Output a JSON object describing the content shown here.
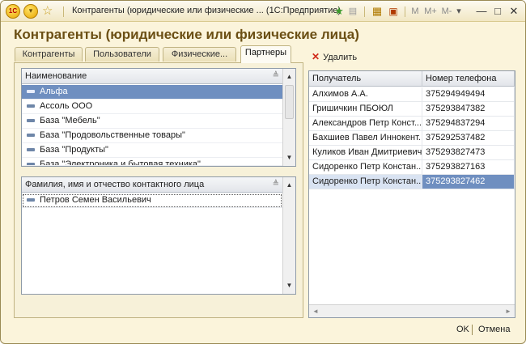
{
  "titlebar": {
    "logo": "1С",
    "title": "Контрагенты (юридические или физические ... (1С:Предприятие)",
    "icons": [
      "1c-logo-icon",
      "menu-icon",
      "star-icon",
      "favorite-icon",
      "document-icon",
      "calculator-icon",
      "calendar-icon"
    ],
    "m_label": "M",
    "mplus_label": "M+",
    "mminus_label": "M-",
    "dropdown_glyph": "▾",
    "minimize_glyph": "—",
    "maximize_glyph": "□",
    "close_glyph": "✕"
  },
  "form": {
    "title": "Контрагенты (юридические или физические лица)"
  },
  "tabs": [
    {
      "label": "Контрагенты",
      "active": false
    },
    {
      "label": "Пользователи",
      "active": false
    },
    {
      "label": "Физические...",
      "active": false
    },
    {
      "label": "Партнеры",
      "active": true
    }
  ],
  "partners_list": {
    "header": "Наименование",
    "rows": [
      "Альфа",
      "Ассоль ООО",
      "База \"Мебель\"",
      "База \"Продовольственные товары\"",
      "База \"Продукты\"",
      "База \"Электроника и бытовая техника\""
    ],
    "selected_index": 0
  },
  "contacts_list": {
    "header": "Фамилия, имя и отчество контактного лица",
    "rows": [
      "Петров Семен Васильевич"
    ]
  },
  "actions": {
    "delete_label": "Удалить"
  },
  "recipients_table": {
    "columns": [
      "Получатель",
      "Номер телефона"
    ],
    "rows": [
      [
        "Алхимов А.А.",
        "375294949494"
      ],
      [
        "Гришичкин ПБОЮЛ",
        "375293847382"
      ],
      [
        "Александров Петр Конст...",
        "375294837294"
      ],
      [
        "Бахшиев Павел Иннокент...",
        "375292537482"
      ],
      [
        "Куликов Иван Дмитриевич",
        "375293827473"
      ],
      [
        "Сидоренко Петр Констан...",
        "375293827163"
      ],
      [
        "Сидоренко Петр Констан...",
        "375293827462"
      ]
    ],
    "selected_index": 6
  },
  "footer": {
    "ok_label": "OK",
    "cancel_label": "Отмена"
  },
  "colors": {
    "title": "#6b4f14",
    "selection": "#6f8fc0",
    "window_bg": "#fbf4db",
    "delete_icon": "#d02a1a"
  }
}
